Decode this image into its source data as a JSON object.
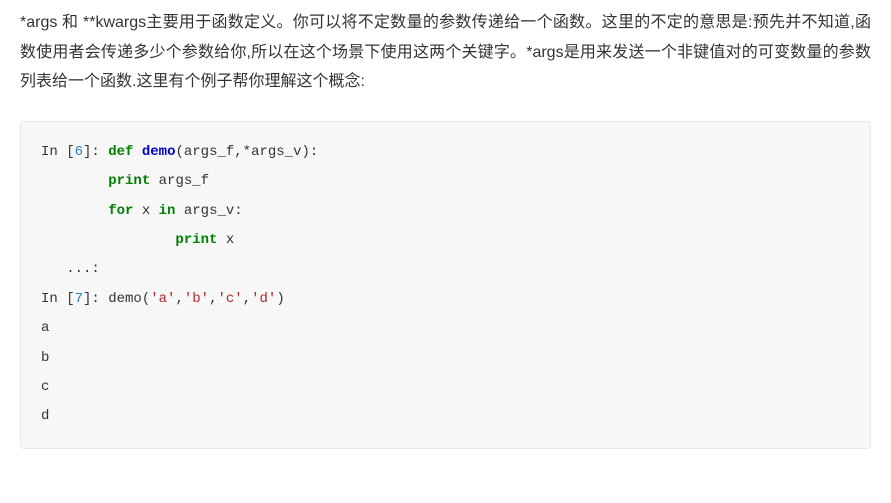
{
  "description": "*args 和 **kwargs主要用于函数定义。你可以将不定数量的参数传递给一个函数。这里的不定的意思是:预先并不知道,函数使用者会传递多少个参数给你,所以在这个场景下使用这两个关键字。*args是用来发送一个非键值对的可变数量的参数列表给一个函数.这里有个例子帮你理解这个概念:",
  "code": {
    "l1_in": "In [",
    "l1_num": "6",
    "l1_close": "]: ",
    "l1_def": "def",
    "l1_sp": " ",
    "l1_fn": "demo",
    "l1_rest": "(args_f,*args_v):",
    "l2_indent": "        ",
    "l2_kw": "print",
    "l2_rest": " args_f",
    "l3_indent": "        ",
    "l3_for": "for",
    "l3_mid": " x ",
    "l3_in": "in",
    "l3_rest": " args_v:",
    "l4_indent": "                ",
    "l4_kw": "print",
    "l4_rest": " x",
    "l5": "   ...:",
    "l6": "",
    "l7_in": "In [",
    "l7_num": "7",
    "l7_close": "]: demo(",
    "l7_s1": "'a'",
    "l7_c1": ",",
    "l7_s2": "'b'",
    "l7_c2": ",",
    "l7_s3": "'c'",
    "l7_c3": ",",
    "l7_s4": "'d'",
    "l7_end": ")",
    "l8": "a",
    "l9": "b",
    "l10": "c",
    "l11": "d"
  }
}
